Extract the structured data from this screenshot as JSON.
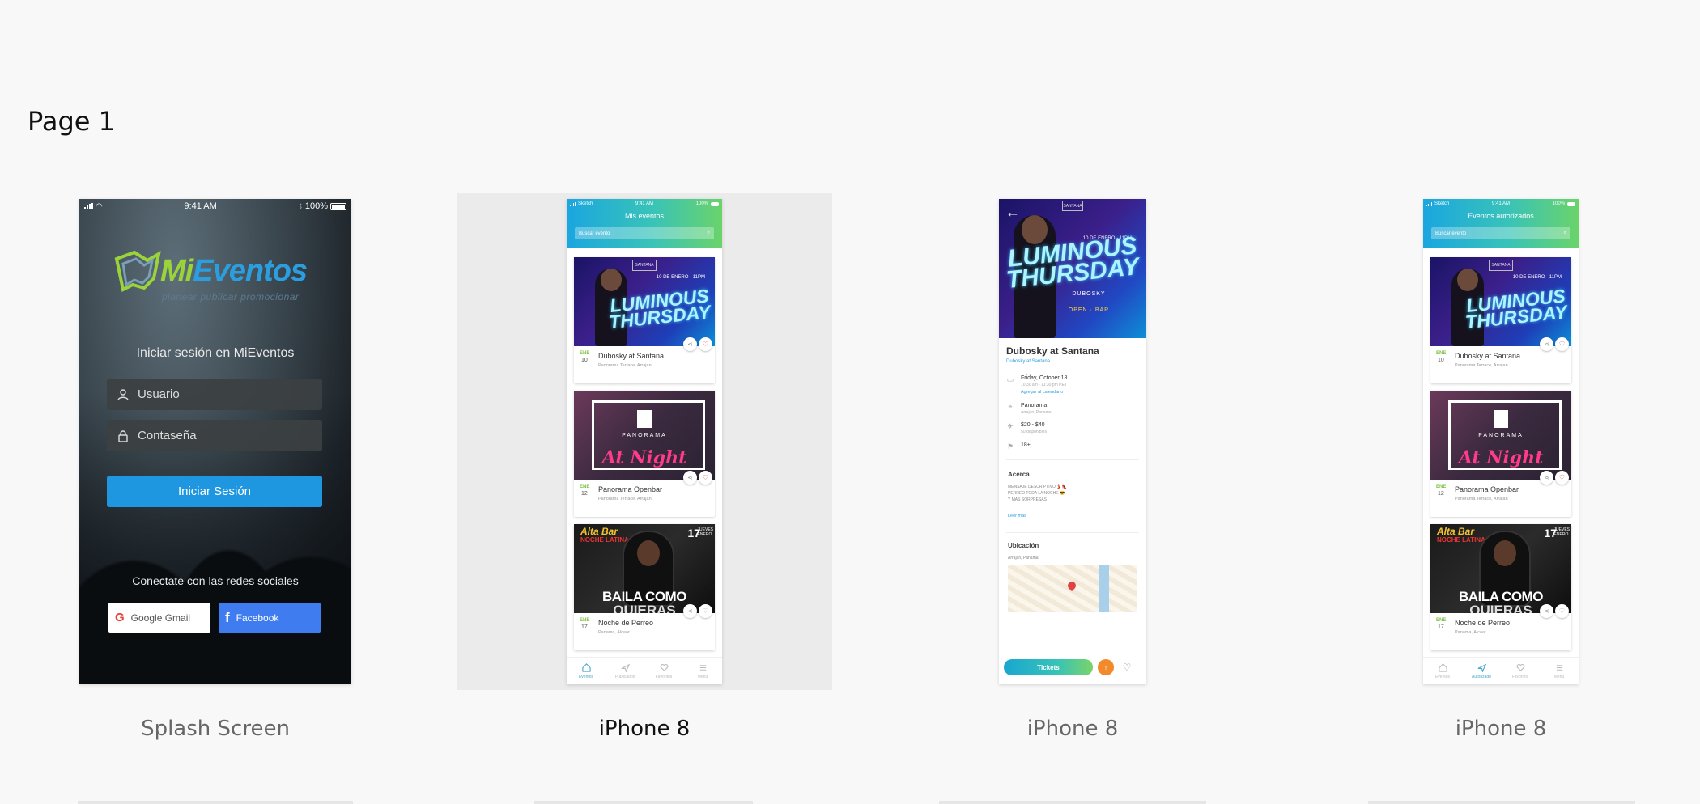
{
  "page": {
    "title": "Page 1"
  },
  "artboards": [
    {
      "caption": "Splash Screen"
    },
    {
      "caption": "iPhone 8"
    },
    {
      "caption": "iPhone 8"
    },
    {
      "caption": "iPhone 8"
    }
  ],
  "splash": {
    "status": {
      "time": "9:41 AM",
      "battery": "100%"
    },
    "logo": {
      "brand_mi": "Mi",
      "brand_ev": "Eventos",
      "tagline": "planear  publicar  promocionar"
    },
    "login_title": "Iniciar sesión en MiEventos",
    "username_placeholder": "Usuario",
    "password_placeholder": "Contaseña",
    "login_button": "Iniciar Sesión",
    "social_title": "Conectate con las redes sociales",
    "google_button": "Google Gmail",
    "facebook_button": "Facebook"
  },
  "my_events": {
    "status": {
      "carrier": "Sketch",
      "time": "9:41 AM",
      "battery": "100%"
    },
    "title": "Mis eventos",
    "search_placeholder": "Buscar evento",
    "events": [
      {
        "month": "ENE",
        "day": "10",
        "name": "Dubosky at Santana",
        "venue": "Panorama Terrace, Arrajan",
        "flyer": {
          "brand": "SANTANA",
          "date": "10 DE ENERO - 11PM",
          "headline": "LUMINOUS THURSDAY"
        }
      },
      {
        "month": "ENE",
        "day": "12",
        "name": "Panorama Openbar",
        "venue": "Panorama Terrace, Arrajan",
        "flyer": {
          "brand": "PANORAMA",
          "headline": "At Night"
        }
      },
      {
        "month": "ENE",
        "day": "17",
        "name": "Noche de Perreo",
        "venue": "Panama, Alcaar",
        "flyer": {
          "brand": "Alta Bar",
          "tag": "NOCHE LATINA",
          "day": "17",
          "weekday": "JUEVES",
          "month": "ENERO",
          "headline1": "BAILA COMO",
          "headline2": "QUIERAS"
        }
      }
    ],
    "tabs": [
      "Eventos",
      "Publicados",
      "Favoritos",
      "Menu"
    ]
  },
  "detail": {
    "flyer": {
      "brand": "SANTANA",
      "date": "10 DE ENERO - 11PM",
      "headline": "LUMINOUS THURSDAY",
      "dj": "DUBOSKY",
      "bar": "OPEN · BAR"
    },
    "title": "Dubosky at Santana",
    "subtitle": "Dubosky at Santana",
    "date_line": "Friday, October 18",
    "time_line": "10:30 am - 11:30 pm PET",
    "calendar_link": "Agregar al calendario",
    "venue": "Panorama",
    "venue_address": "Arrajan, Panama",
    "price": "$20 - $40",
    "price_note": "50 disponibles",
    "age": "18+",
    "about_heading": "Acerca",
    "about_lines": [
      "MENSAJE DESCRIPTIVO 💃🏻👠",
      "PERREO TODA LA NOCHE 😎",
      "Y MAS SORPRESAS"
    ],
    "read_more": "Leer más",
    "location_heading": "Ubicación",
    "location_address": "Arrajan, Panama",
    "tickets_button": "Tickets"
  },
  "authorized": {
    "status": {
      "carrier": "Sketch",
      "time": "9:41 AM",
      "battery": "100%"
    },
    "title": "Eventos autorizados",
    "search_placeholder": "Buscar evento",
    "tabs": [
      "Eventos",
      "Autorizado",
      "Favoritos",
      "Menu"
    ]
  },
  "colors": {
    "accent_blue": "#1e97e0",
    "facebook": "#3f7cf0",
    "brand_green": "#9bd33a",
    "like_red": "#d0304a",
    "tickets_orange": "#f28a2b"
  }
}
